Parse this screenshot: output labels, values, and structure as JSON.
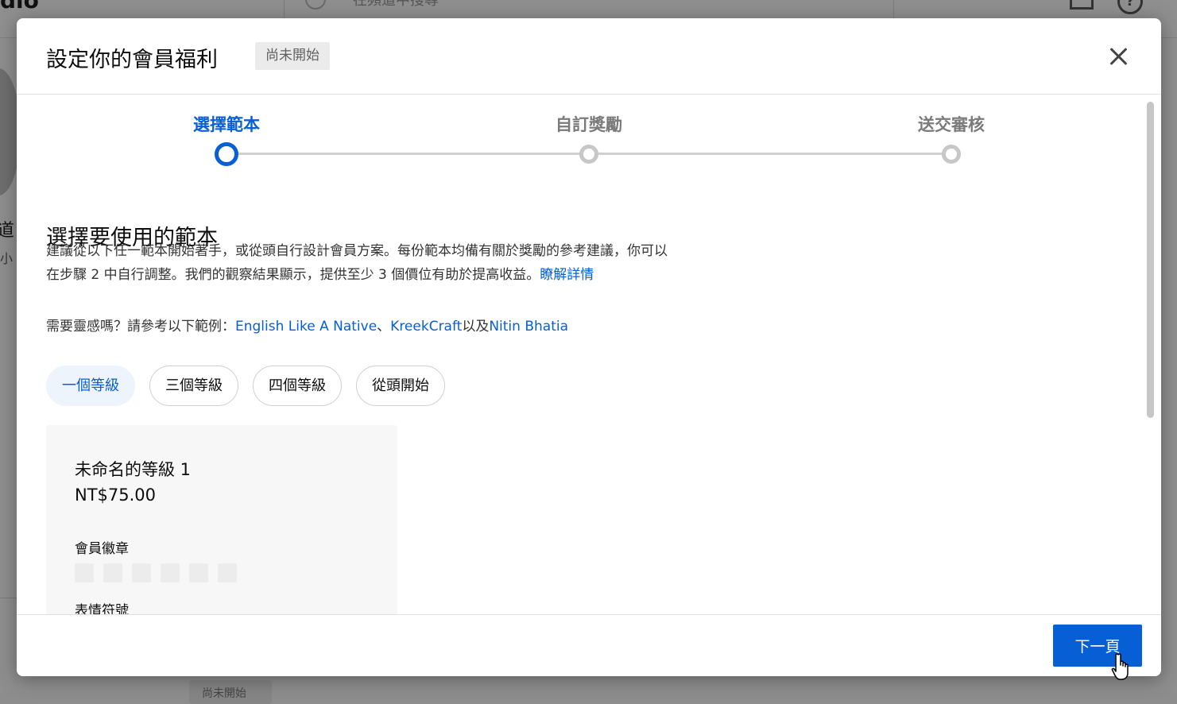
{
  "background": {
    "logo_text": "dio",
    "search_placeholder": "在頻道中搜尋",
    "side_char_1": "道",
    "side_char_2": "小",
    "bottom_badge": "尚未開始"
  },
  "modal": {
    "title": "設定你的會員福利",
    "status_chip": "尚未開始",
    "close_icon": "close-icon"
  },
  "stepper": {
    "steps": [
      {
        "label": "選擇範本",
        "state": "active"
      },
      {
        "label": "自訂獎勵",
        "state": "inactive"
      },
      {
        "label": "送交審核",
        "state": "inactive"
      }
    ],
    "active_color": "#065fd4"
  },
  "content": {
    "section_title": "選擇要使用的範本",
    "description_line1": "建議從以下任一範本開始著手，或從頭自行設計會員方案。每份範本均備有關於獎勵的參考建議，你可以",
    "description_line2": "在步驟 2 中自行調整。我們的觀察結果顯示，提供至少 3 個價位有助於提高收益。",
    "learn_more": "瞭解詳情",
    "inspire_prefix": "需要靈感嗎？請參考以下範例：",
    "example_1": "English Like A Native",
    "separator_1": "、",
    "example_2": "KreekCraft",
    "separator_2": "以及",
    "example_3": "Nitin Bhatia"
  },
  "template_chips": [
    {
      "label": "一個等級",
      "selected": true
    },
    {
      "label": "三個等級",
      "selected": false
    },
    {
      "label": "四個等級",
      "selected": false
    },
    {
      "label": "從頭開始",
      "selected": false
    }
  ],
  "tier_card": {
    "name": "未命名的等級 1",
    "price": "NT$75.00",
    "perks": [
      {
        "label": "會員徽章",
        "placeholder_count": 6
      },
      {
        "label": "表情符號",
        "placeholder_count": 4
      }
    ]
  },
  "footer": {
    "next_label": "下一頁"
  },
  "colors": {
    "accent": "#065fd4",
    "chip_selected_bg": "#eef4fc",
    "overlay": "#8e8e8e"
  }
}
